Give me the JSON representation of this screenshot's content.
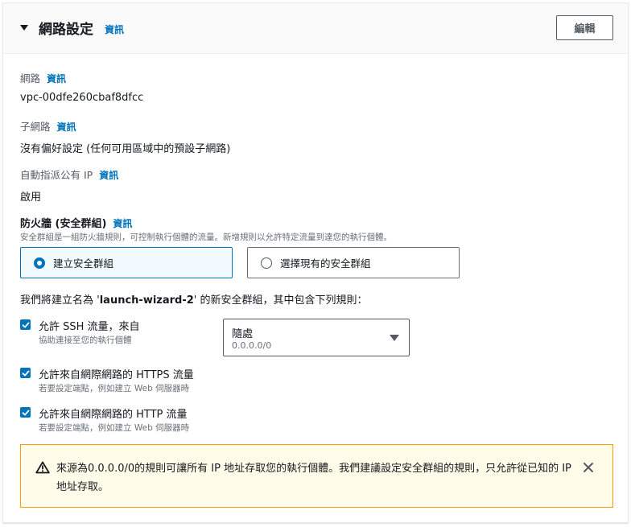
{
  "section": {
    "title": "網路設定",
    "info_link": "資訊",
    "edit_button": "編輯"
  },
  "fields": {
    "network": {
      "label": "網路",
      "info": "資訊",
      "value": "vpc-00dfe260cbaf8dfcc"
    },
    "subnet": {
      "label": "子網路",
      "info": "資訊",
      "value": "沒有偏好設定 (任何可用區域中的預設子網路)"
    },
    "public_ip": {
      "label": "自動指派公有 IP",
      "info": "資訊",
      "value": "啟用"
    }
  },
  "firewall": {
    "label": "防火牆 (安全群組)",
    "info": "資訊",
    "description": "安全群組是一組防火牆規則，可控制執行個體的流量。新增規則以允許特定流量到達您的執行個體。",
    "options": [
      {
        "label": "建立安全群組",
        "selected": true
      },
      {
        "label": "選擇現有的安全群組",
        "selected": false
      }
    ],
    "intro_prefix": "我們將建立名為 '",
    "group_name": "launch-wizard-2",
    "intro_suffix": "' 的新安全群組，其中包含下列規則："
  },
  "rules": {
    "ssh": {
      "label": "允許 SSH 流量，來自",
      "desc": "協助連接至您的執行個體",
      "checked": true
    },
    "ssh_source": {
      "value": "隨處",
      "sub": "0.0.0.0/0"
    },
    "https": {
      "label": "允許來自網際網路的 HTTPS 流量",
      "desc": "若要設定端點，例如建立 Web 伺服器時",
      "checked": true
    },
    "http": {
      "label": "允許來自網際網路的 HTTP 流量",
      "desc": "若要設定端點，例如建立 Web 伺服器時",
      "checked": true
    }
  },
  "alert": {
    "text": "來源為0.0.0.0/0的規則可讓所有 IP 地址存取您的執行個體。我們建議設定安全群組的規則，只允許從已知的 IP 地址存取。"
  },
  "colors": {
    "accent": "#0073bb",
    "warning_border": "#ff9900",
    "warning_bg": "#fffce9"
  }
}
